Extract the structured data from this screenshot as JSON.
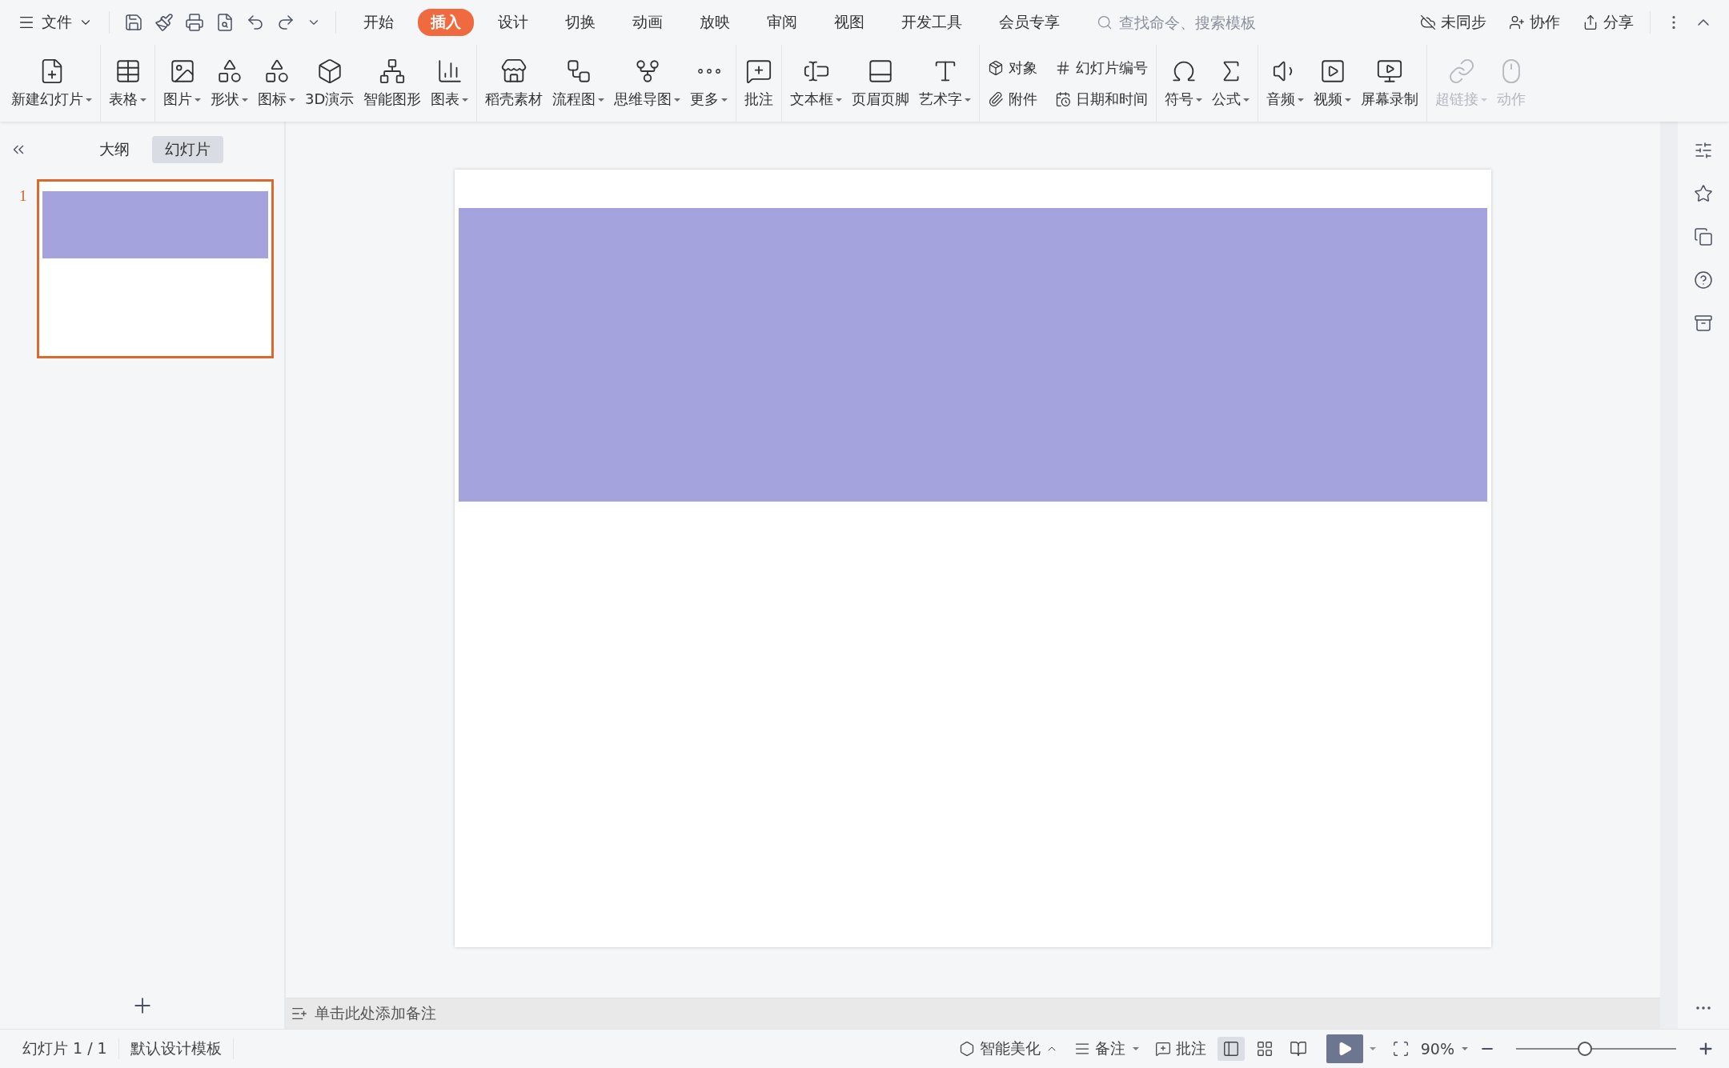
{
  "menu": {
    "label": "文件"
  },
  "tabs": [
    {
      "label": "开始",
      "selected": false
    },
    {
      "label": "插入",
      "selected": true
    },
    {
      "label": "设计",
      "selected": false
    },
    {
      "label": "切换",
      "selected": false
    },
    {
      "label": "动画",
      "selected": false
    },
    {
      "label": "放映",
      "selected": false
    },
    {
      "label": "审阅",
      "selected": false
    },
    {
      "label": "视图",
      "selected": false
    },
    {
      "label": "开发工具",
      "selected": false
    },
    {
      "label": "会员专享",
      "selected": false
    }
  ],
  "search": {
    "placeholder": "查找命令、搜索模板"
  },
  "actions": [
    "未同步",
    "协作",
    "分享"
  ],
  "ribbon_groups": [
    {
      "kind": "big",
      "items": [
        {
          "label": "新建幻灯片",
          "dropdown": true,
          "disabled": false
        }
      ]
    },
    {
      "kind": "big",
      "items": [
        {
          "label": "表格",
          "dropdown": true,
          "disabled": false
        }
      ]
    },
    {
      "kind": "big",
      "items": [
        {
          "label": "图片",
          "dropdown": true,
          "disabled": false
        },
        {
          "label": "形状",
          "dropdown": true,
          "disabled": false
        },
        {
          "label": "图标",
          "dropdown": true,
          "disabled": false
        },
        {
          "label": "3D演示",
          "dropdown": false,
          "disabled": false
        },
        {
          "label": "智能图形",
          "dropdown": false,
          "disabled": false
        },
        {
          "label": "图表",
          "dropdown": true,
          "disabled": false
        }
      ]
    },
    {
      "kind": "big",
      "items": [
        {
          "label": "稻壳素材",
          "dropdown": false,
          "disabled": false
        },
        {
          "label": "流程图",
          "dropdown": true,
          "disabled": false
        },
        {
          "label": "思维导图",
          "dropdown": true,
          "disabled": false
        },
        {
          "label": "更多",
          "dropdown": true,
          "disabled": false
        }
      ]
    },
    {
      "kind": "big",
      "items": [
        {
          "label": "批注",
          "dropdown": false,
          "disabled": false
        }
      ]
    },
    {
      "kind": "big",
      "items": [
        {
          "label": "文本框",
          "dropdown": true,
          "disabled": false
        },
        {
          "label": "页眉页脚",
          "dropdown": false,
          "disabled": false
        },
        {
          "label": "艺术字",
          "dropdown": true,
          "disabled": false
        }
      ]
    },
    {
      "kind": "small",
      "items": [
        {
          "label": "对象",
          "dropdown": false,
          "disabled": false
        },
        {
          "label": "附件",
          "dropdown": false,
          "disabled": false
        },
        {
          "label": "幻灯片编号",
          "dropdown": false,
          "disabled": false
        },
        {
          "label": "日期和时间",
          "dropdown": false,
          "disabled": false
        }
      ]
    },
    {
      "kind": "big",
      "items": [
        {
          "label": "符号",
          "dropdown": true,
          "disabled": false
        },
        {
          "label": "公式",
          "dropdown": true,
          "disabled": false
        }
      ]
    },
    {
      "kind": "big",
      "items": [
        {
          "label": "音频",
          "dropdown": true,
          "disabled": false
        },
        {
          "label": "视频",
          "dropdown": true,
          "disabled": false
        },
        {
          "label": "屏幕录制",
          "dropdown": false,
          "disabled": false
        }
      ]
    },
    {
      "kind": "big",
      "items": [
        {
          "label": "超链接",
          "dropdown": true,
          "disabled": true
        },
        {
          "label": "动作",
          "dropdown": false,
          "disabled": true
        }
      ]
    }
  ],
  "view_tabs": [
    {
      "label": "大纲",
      "selected": false
    },
    {
      "label": "幻灯片",
      "selected": true
    }
  ],
  "slides": [
    {
      "number": "1",
      "selected": true
    }
  ],
  "notes": {
    "placeholder": "单击此处添加备注"
  },
  "status_bar": {
    "slide_info": "幻灯片 1 / 1",
    "template": "默认设计模板",
    "beautify": "智能美化",
    "notes": "备注",
    "comments": "批注",
    "views": [
      {
        "kind": "normal",
        "selected": true
      },
      {
        "kind": "sorter",
        "selected": false
      },
      {
        "kind": "reading",
        "selected": false
      }
    ],
    "zoom": "90%",
    "zoom_slider": {
      "level": 0.43
    }
  }
}
